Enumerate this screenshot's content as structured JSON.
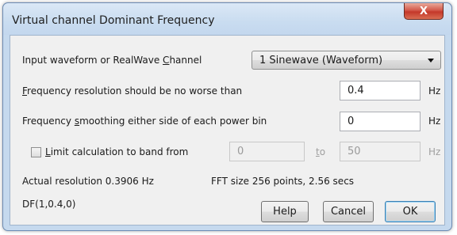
{
  "window": {
    "title": "Virtual channel Dominant Frequency",
    "close_label": "X"
  },
  "form": {
    "input_waveform": {
      "label_pre": "Input waveform or RealWave ",
      "label_accel": "C",
      "label_post": "hannel",
      "selected": "1 Sinewave (Waveform)"
    },
    "frequency_resolution": {
      "label_accel": "F",
      "label_post": "requency resolution should be no worse than",
      "value": "0.4",
      "unit": "Hz"
    },
    "frequency_smoothing": {
      "label_pre": "Frequency ",
      "label_accel": "s",
      "label_post": "moothing either side of each  power bin",
      "value": "0",
      "unit": "Hz"
    },
    "limit_band": {
      "checked": false,
      "label_accel": "L",
      "label_post": "imit calculation to band from",
      "from_value": "0",
      "to_accel": "t",
      "to_post": "o",
      "to_value": "50",
      "unit": "Hz"
    }
  },
  "info": {
    "actual_resolution": "Actual resolution  0.3906 Hz",
    "fft_size": "FFT size  256 points, 2.56 secs",
    "expression": "DF(1,0.4,0)"
  },
  "buttons": {
    "help": "Help",
    "cancel": "Cancel",
    "ok": "OK"
  }
}
